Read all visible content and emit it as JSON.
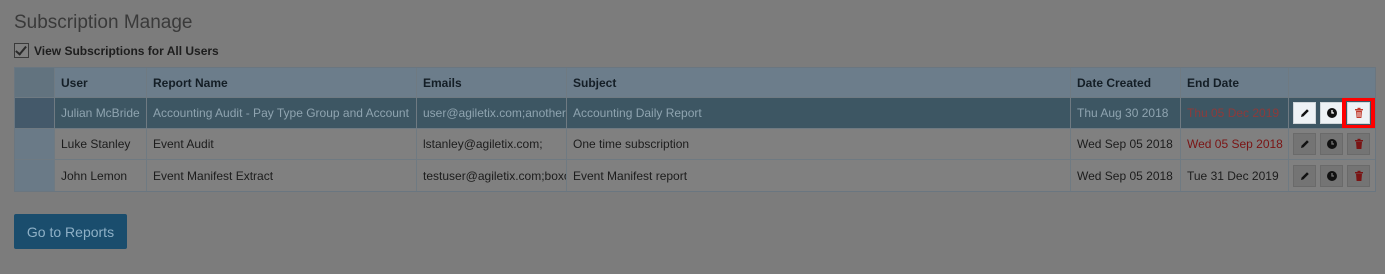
{
  "page_title": "Subscription Manage",
  "view_all": {
    "label": "View Subscriptions for All Users",
    "checked": true
  },
  "table": {
    "headers": {
      "user": "User",
      "report": "Report Name",
      "emails": "Emails",
      "subject": "Subject",
      "created": "Date Created",
      "end": "End Date"
    },
    "rows": [
      {
        "user": "Julian McBride",
        "report": "Accounting Audit - Pay Type Group and Account",
        "emails": "user@agiletix.com;another",
        "subject": "Accounting Daily Report",
        "created": "Thu Aug 30 2018",
        "end": "Thu 05 Dec 2019",
        "selected": true,
        "end_overdue": false
      },
      {
        "user": "Luke Stanley",
        "report": "Event Audit",
        "emails": "lstanley@agiletix.com;",
        "subject": "One time subscription",
        "created": "Wed Sep 05 2018",
        "end": "Wed 05 Sep 2018",
        "selected": false,
        "end_overdue": true
      },
      {
        "user": "John Lemon",
        "report": "Event Manifest Extract",
        "emails": "testuser@agiletix.com;boxo",
        "subject": "Event Manifest report",
        "created": "Wed Sep 05 2018",
        "end": "Tue 31 Dec 2019",
        "selected": false,
        "end_overdue": false
      }
    ],
    "actions": [
      "pencil-icon",
      "clock-icon",
      "trash-icon"
    ]
  },
  "go_to_reports_label": "Go to Reports",
  "colors": {
    "accent": "#1a4d6d",
    "delete": "#c0392b",
    "highlight": "#ff0000",
    "overdue": "#b22222"
  }
}
